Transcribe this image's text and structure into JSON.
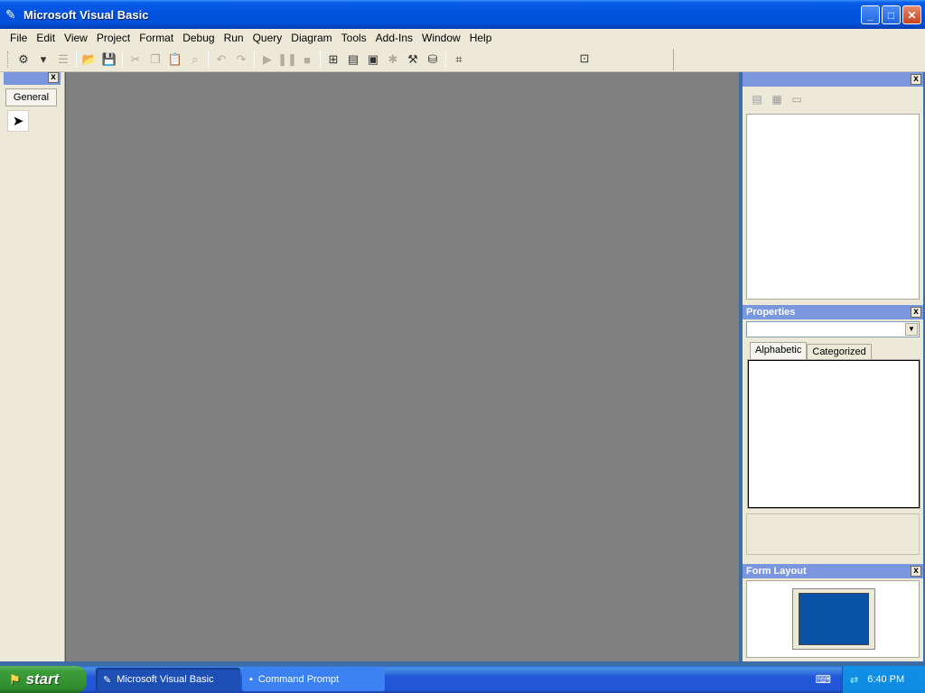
{
  "window": {
    "title": "Microsoft Visual Basic",
    "minimize": "_",
    "maximize": "□",
    "close": "✕"
  },
  "menu": [
    "File",
    "Edit",
    "View",
    "Project",
    "Format",
    "Debug",
    "Run",
    "Query",
    "Diagram",
    "Tools",
    "Add-Ins",
    "Window",
    "Help"
  ],
  "toolbox": {
    "tab_label": "General",
    "close": "x"
  },
  "panels": {
    "project_close": "x",
    "properties_title": "Properties",
    "properties_close": "x",
    "tab_alphabetic": "Alphabetic",
    "tab_categorized": "Categorized",
    "form_layout_title": "Form Layout",
    "form_layout_close": "x"
  },
  "taskbar": {
    "start_label": "start",
    "tasks": [
      "Microsoft Visual Basic",
      "Command Prompt"
    ],
    "clock": "6:40 PM"
  }
}
